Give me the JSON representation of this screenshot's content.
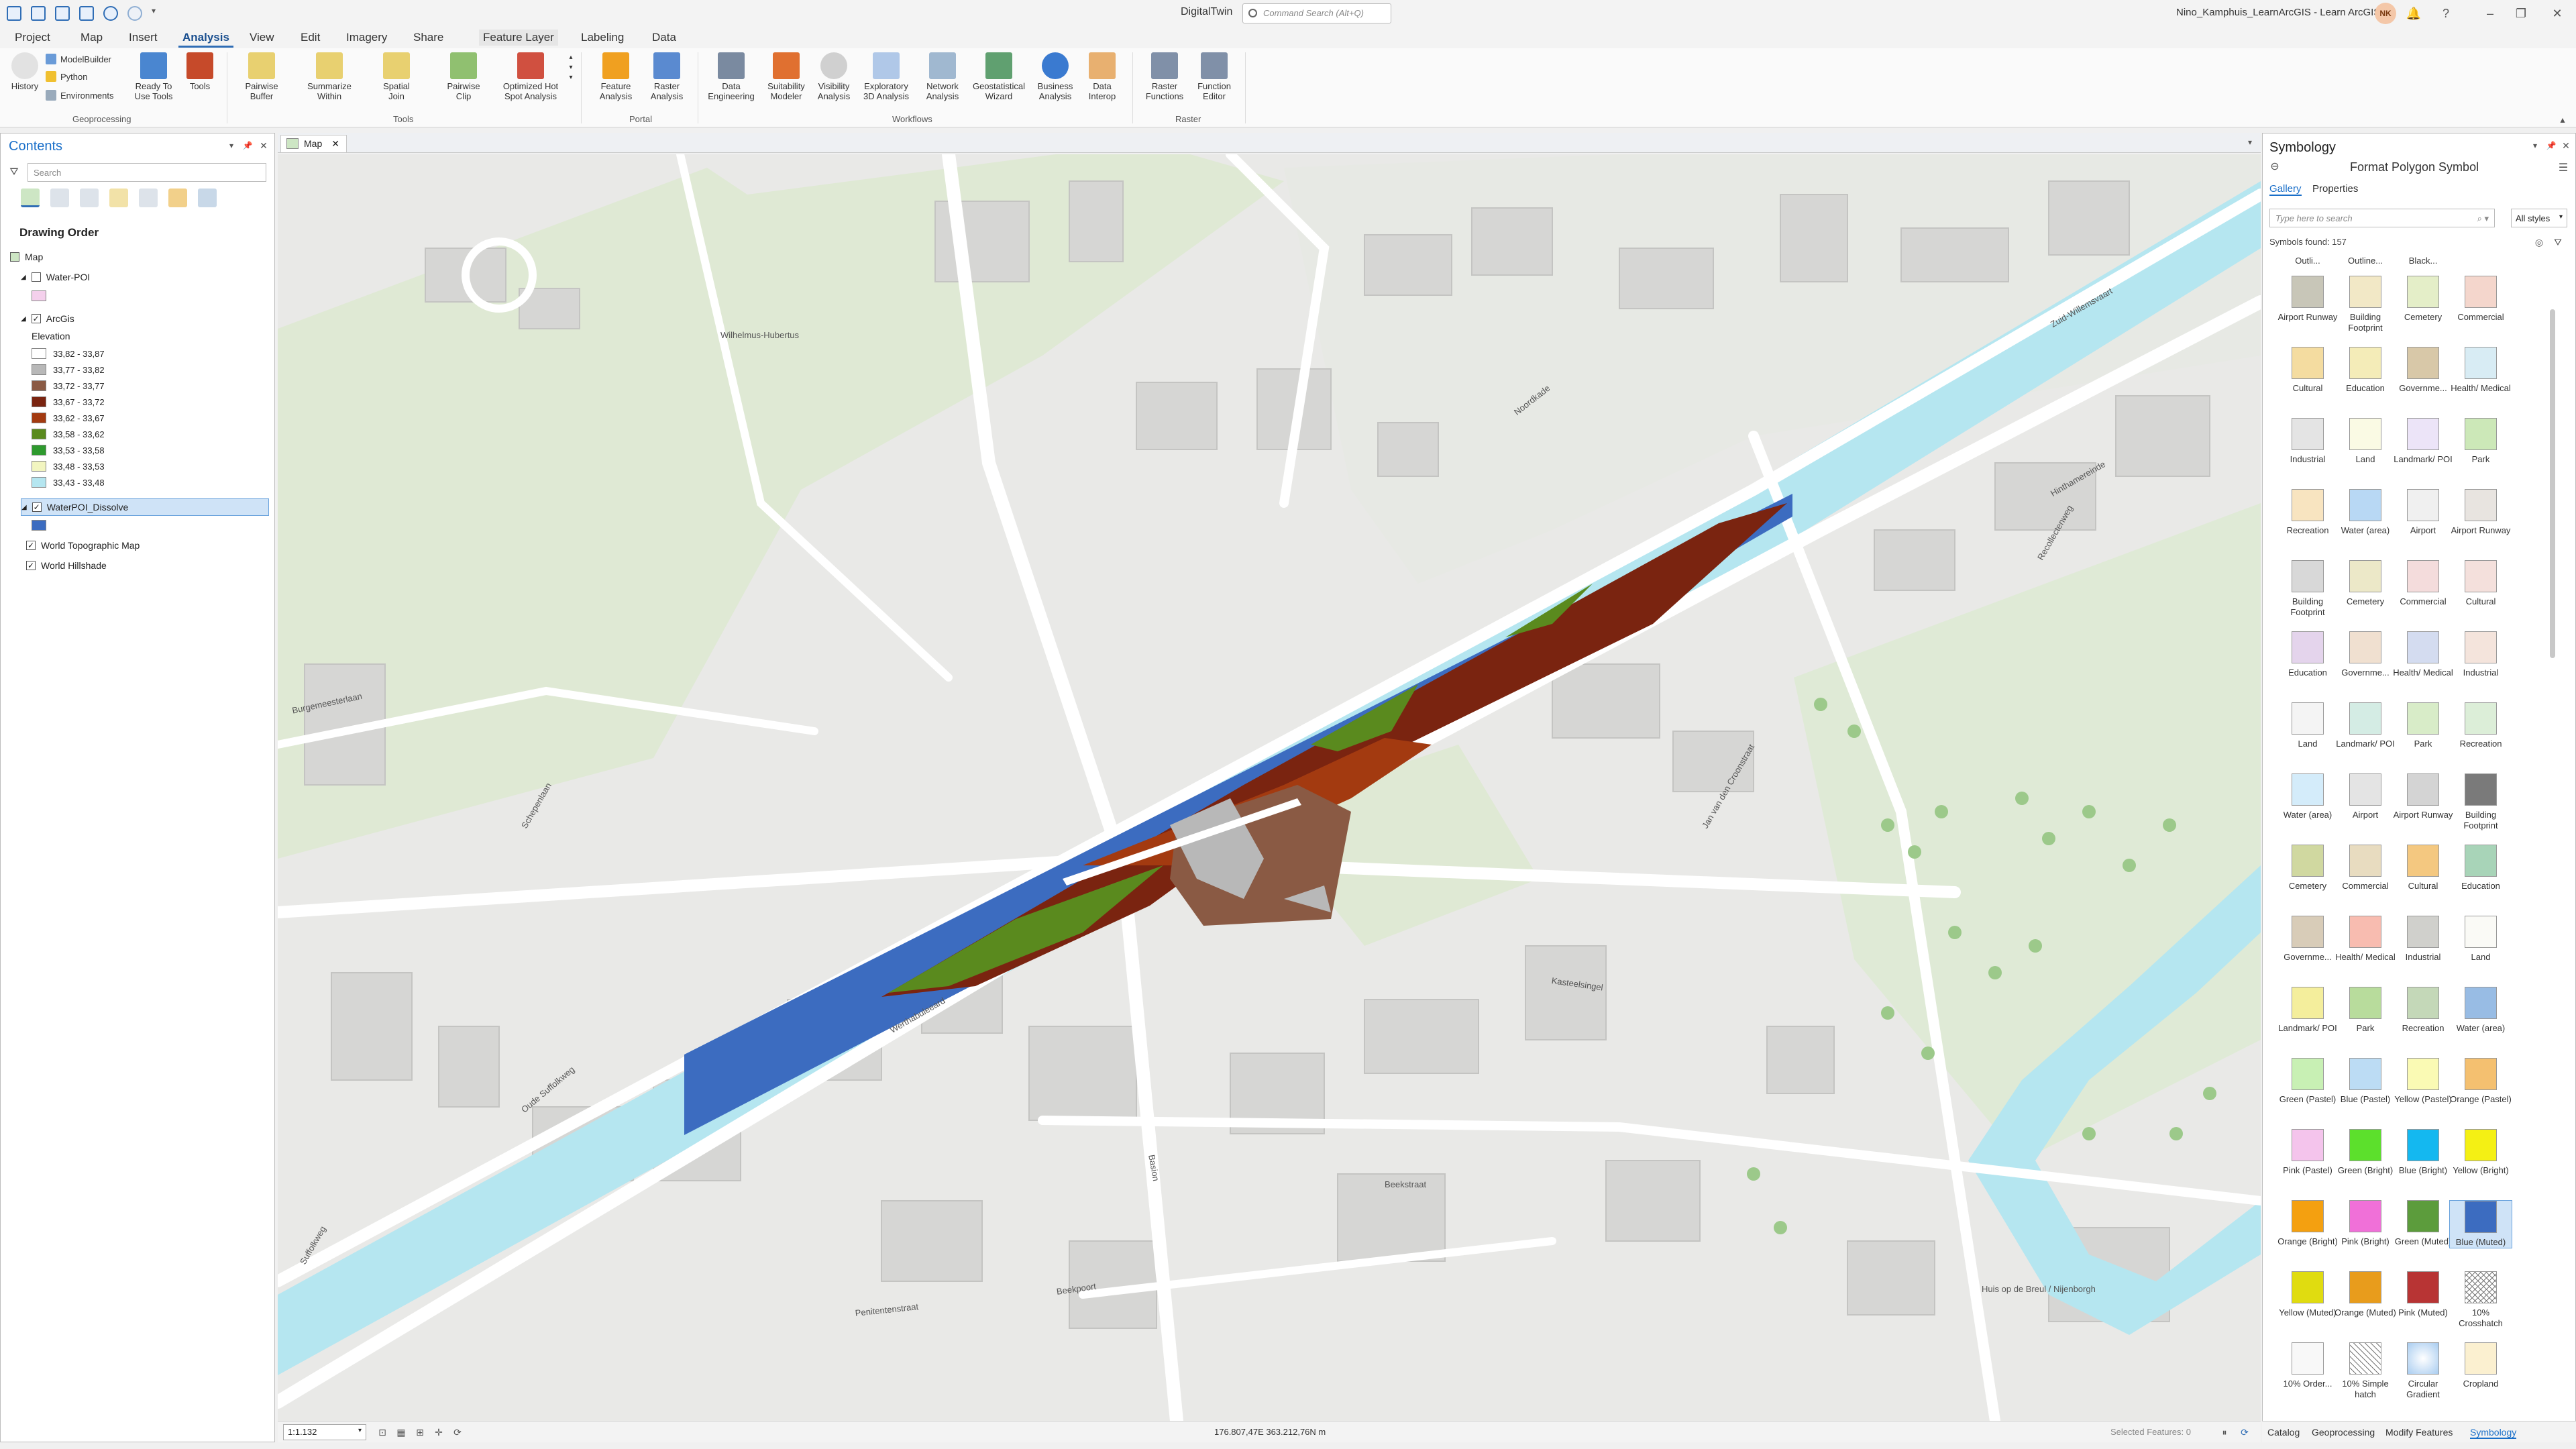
{
  "app": {
    "title": "DigitalTwin",
    "command_search_placeholder": "Command Search (Alt+Q)",
    "user": "Nino_Kamphuis_LearnArcGIS - Learn ArcGIS",
    "avatar_initials": "NK"
  },
  "ribbon_tabs": [
    "Project",
    "Map",
    "Insert",
    "Analysis",
    "View",
    "Edit",
    "Imagery",
    "Share",
    "Feature Layer",
    "Labeling",
    "Data"
  ],
  "ribbon": {
    "geoprocessing": {
      "history": "History",
      "modelbuilder": "ModelBuilder",
      "python": "Python",
      "environments": "Environments",
      "ready_to_use_1": "Ready To",
      "ready_to_use_2": "Use Tools",
      "tools": "Tools",
      "group": "Geoprocessing"
    },
    "tools": {
      "pairwise_buffer_1": "Pairwise",
      "pairwise_buffer_2": "Buffer",
      "summarize_within_1": "Summarize",
      "summarize_within_2": "Within",
      "spatial_join_1": "Spatial",
      "spatial_join_2": "Join",
      "pairwise_clip_1": "Pairwise",
      "pairwise_clip_2": "Clip",
      "hot_spot_1": "Optimized Hot",
      "hot_spot_2": "Spot Analysis",
      "group": "Tools"
    },
    "portal": {
      "feature_analysis_1": "Feature",
      "feature_analysis_2": "Analysis",
      "raster_analysis_1": "Raster",
      "raster_analysis_2": "Analysis",
      "group": "Portal"
    },
    "workflows": {
      "data_eng_1": "Data",
      "data_eng_2": "Engineering",
      "suitability_1": "Suitability",
      "suitability_2": "Modeler",
      "visibility_1": "Visibility",
      "visibility_2": "Analysis",
      "exploratory_1": "Exploratory",
      "exploratory_2": "3D Analysis",
      "network_1": "Network",
      "network_2": "Analysis",
      "geostat_1": "Geostatistical",
      "geostat_2": "Wizard",
      "business_1": "Business",
      "business_2": "Analysis",
      "interop_1": "Data",
      "interop_2": "Interop",
      "group": "Workflows"
    },
    "raster": {
      "raster_functions_1": "Raster",
      "raster_functions_2": "Functions",
      "function_editor_1": "Function",
      "function_editor_2": "Editor",
      "group": "Raster"
    }
  },
  "contents": {
    "title": "Contents",
    "search_placeholder": "Search",
    "drawing_order": "Drawing Order",
    "map_name": "Map",
    "layer_water_poi": "Water-POI",
    "layer_arcgis": "ArcGis",
    "elevation_label": "Elevation",
    "ramp": [
      {
        "label": "33,82 - 33,87",
        "color": "#ffffff"
      },
      {
        "label": "33,77 - 33,82",
        "color": "#b8b8b8"
      },
      {
        "label": "33,72 - 33,77",
        "color": "#8a5a44"
      },
      {
        "label": "33,67 - 33,72",
        "color": "#7a2410"
      },
      {
        "label": "33,62 - 33,67",
        "color": "#a33a10"
      },
      {
        "label": "33,58 - 33,62",
        "color": "#5a8a1e"
      },
      {
        "label": "33,53 - 33,58",
        "color": "#2e9a2e"
      },
      {
        "label": "33,48 - 33,53",
        "color": "#f2f5c0"
      },
      {
        "label": "33,43 - 33,48",
        "color": "#b5e6f0"
      }
    ],
    "layer_dissolve": "WaterPOI_Dissolve",
    "layer_topo": "World Topographic Map",
    "layer_hillshade": "World Hillshade"
  },
  "map": {
    "tab_label": "Map",
    "scale": "1:1.132",
    "coordinates": "176.807,47E 363.212,76N m",
    "selected_features": "Selected Features: 0",
    "streets": [
      "Wilhelmus-Hubertus",
      "Noordkade",
      "Zuid-Willemsvaart",
      "Burgemeesterlaan",
      "Schepenlaan",
      "Oude Suffolkweg",
      "Werthabuleeard",
      "Kasteelsingel",
      "Beekstraat",
      "Beekpoort",
      "Penitentenstraat",
      "Jan van den Croonstraat",
      "Recollectenweg",
      "Hinthamereinde",
      "Suffolkweg",
      "Basion",
      "Huis op de Breul / Nijenborgh"
    ]
  },
  "symbology": {
    "title": "Symbology",
    "subtitle": "Format Polygon Symbol",
    "tab_gallery": "Gallery",
    "tab_properties": "Properties",
    "search_placeholder": "Type here to search",
    "style_filter": "All styles",
    "symbols_found": "Symbols found: 157",
    "partial_row": [
      "Outli...",
      "Outline...",
      "Black...",
      ""
    ],
    "gallery": [
      {
        "name": "Airport Runway",
        "color": "#c8c6b8"
      },
      {
        "name": "Building Footprint",
        "color": "#f2e8c6"
      },
      {
        "name": "Cemetery",
        "color": "#e4eec8"
      },
      {
        "name": "Commercial",
        "color": "#f4d6cc"
      },
      {
        "name": "Cultural",
        "color": "#f4dca0"
      },
      {
        "name": "Education",
        "color": "#f4ecb8"
      },
      {
        "name": "Governme...",
        "color": "#d8c8a8"
      },
      {
        "name": "Health/ Medical",
        "color": "#d8ecf4"
      },
      {
        "name": "Industrial",
        "color": "#e4e4e4"
      },
      {
        "name": "Land",
        "color": "#fafae4"
      },
      {
        "name": "Landmark/ POI",
        "color": "#ece4f8"
      },
      {
        "name": "Park",
        "color": "#cce8b8"
      },
      {
        "name": "Recreation",
        "color": "#f8e4c0"
      },
      {
        "name": "Water (area)",
        "color": "#b8d8f4"
      },
      {
        "name": "Airport",
        "color": "#f0f0f0"
      },
      {
        "name": "Airport Runway",
        "color": "#e8e4e0"
      },
      {
        "name": "Building Footprint",
        "color": "#d8d8d8"
      },
      {
        "name": "Cemetery",
        "color": "#ece8c8"
      },
      {
        "name": "Commercial",
        "color": "#f4dcdc"
      },
      {
        "name": "Cultural",
        "color": "#f4e0dc"
      },
      {
        "name": "Education",
        "color": "#e4d4ec"
      },
      {
        "name": "Governme...",
        "color": "#f0e0d0"
      },
      {
        "name": "Health/ Medical",
        "color": "#d4dcf0"
      },
      {
        "name": "Industrial",
        "color": "#f4e4dc"
      },
      {
        "name": "Land",
        "color": "#f4f4f4"
      },
      {
        "name": "Landmark/ POI",
        "color": "#d4ece4"
      },
      {
        "name": "Park",
        "color": "#d8ecc8"
      },
      {
        "name": "Recreation",
        "color": "#dceed8"
      },
      {
        "name": "Water (area)",
        "color": "#d4ecfa"
      },
      {
        "name": "Airport",
        "color": "#e4e4e4"
      },
      {
        "name": "Airport Runway",
        "color": "#d4d4d4"
      },
      {
        "name": "Building Footprint",
        "color": "#7a7a7a"
      },
      {
        "name": "Cemetery",
        "color": "#d0d8a0"
      },
      {
        "name": "Commercial",
        "color": "#e8dcc0"
      },
      {
        "name": "Cultural",
        "color": "#f4c880"
      },
      {
        "name": "Education",
        "color": "#a8d4b8"
      },
      {
        "name": "Governme...",
        "color": "#d8ccb8"
      },
      {
        "name": "Health/ Medical",
        "color": "#f8bcb0"
      },
      {
        "name": "Industrial",
        "color": "#d0d0cc"
      },
      {
        "name": "Land",
        "color": "#fafaf6"
      },
      {
        "name": "Landmark/ POI",
        "color": "#f4ee9c"
      },
      {
        "name": "Park",
        "color": "#b8dc9c"
      },
      {
        "name": "Recreation",
        "color": "#c4d8b8"
      },
      {
        "name": "Water (area)",
        "color": "#98bce4"
      },
      {
        "name": "Green (Pastel)",
        "color": "#c8f0b4"
      },
      {
        "name": "Blue (Pastel)",
        "color": "#bcdcf4"
      },
      {
        "name": "Yellow (Pastel)",
        "color": "#fafab4"
      },
      {
        "name": "Orange (Pastel)",
        "color": "#f4c070"
      },
      {
        "name": "Pink (Pastel)",
        "color": "#f4c4ec"
      },
      {
        "name": "Green (Bright)",
        "color": "#5ce02c"
      },
      {
        "name": "Blue (Bright)",
        "color": "#14b8f0"
      },
      {
        "name": "Yellow (Bright)",
        "color": "#f4f014"
      },
      {
        "name": "Orange (Bright)",
        "color": "#f4a010"
      },
      {
        "name": "Pink (Bright)",
        "color": "#f070d8"
      },
      {
        "name": "Green (Muted)",
        "color": "#5c9c3c"
      },
      {
        "name": "Blue (Muted)",
        "color": "#3c6cc0"
      },
      {
        "name": "Yellow (Muted)",
        "color": "#e0dc10"
      },
      {
        "name": "Orange (Muted)",
        "color": "#e89c1c"
      },
      {
        "name": "Pink (Muted)",
        "color": "#b83434"
      },
      {
        "name": "10% Crosshatch",
        "color": "#ffffff"
      },
      {
        "name": "10% Order...",
        "color": "#f8f8f8"
      },
      {
        "name": "10% Simple hatch",
        "color": "#ffffff"
      },
      {
        "name": "Circular Gradient",
        "color": "#cce4f8"
      },
      {
        "name": "Cropland",
        "color": "#fbf0d0"
      }
    ]
  },
  "bottom_tabs": [
    "Catalog",
    "Geoprocessing",
    "Modify Features",
    "Symbology"
  ],
  "colors": {
    "accent": "#2f6db5",
    "water": "#b5e6f0",
    "dissolve_blue": "#3c6cc0",
    "map_bg": "#e9e9e7",
    "park": "#d7ead0"
  }
}
